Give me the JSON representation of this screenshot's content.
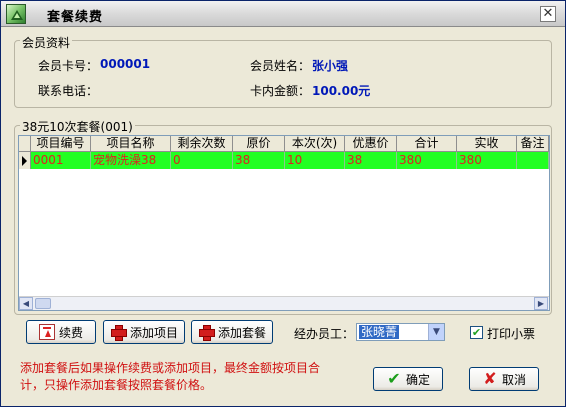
{
  "window": {
    "title": "套餐续费",
    "close_glyph": "✕"
  },
  "member": {
    "group_title": "会员资料",
    "card_no_label": "会员卡号：",
    "card_no": "000001",
    "name_label": "会员姓名：",
    "name": "张小强",
    "phone_label": "联系电话：",
    "phone": "",
    "balance_label": "卡内金额：",
    "balance": "100.00元"
  },
  "package": {
    "group_title": "38元10次套餐(001)",
    "columns": [
      "项目编号",
      "项目名称",
      "剩余次数",
      "原价",
      "本次(次)",
      "优惠价",
      "合计",
      "实收",
      "备注"
    ],
    "rows": [
      {
        "cells": [
          "0001",
          "宠物洗澡38",
          "0",
          "38",
          "10",
          "38",
          "380",
          "380",
          ""
        ]
      }
    ]
  },
  "toolbar": {
    "renew_label": "续费",
    "add_item_label": "添加项目",
    "add_package_label": "添加套餐",
    "staff_label": "经办员工：",
    "staff_value": "张晓菁",
    "print_label": "打印小票",
    "print_checked": true
  },
  "note": "添加套餐后如果操作续费或添加项目，最终金额按项目合计，只操作添加套餐按照套餐价格。",
  "actions": {
    "ok_label": "确定",
    "cancel_label": "取消"
  },
  "icons": {
    "app": "app-icon",
    "close": "close-icon",
    "renew": "renew-icon",
    "add": "plus-icon",
    "ok": "check-icon",
    "cancel": "x-icon"
  },
  "colors": {
    "row_bg": "#22ff22",
    "row_text": "#e02020",
    "value_text": "#0018b8",
    "note_text": "#d01010"
  }
}
